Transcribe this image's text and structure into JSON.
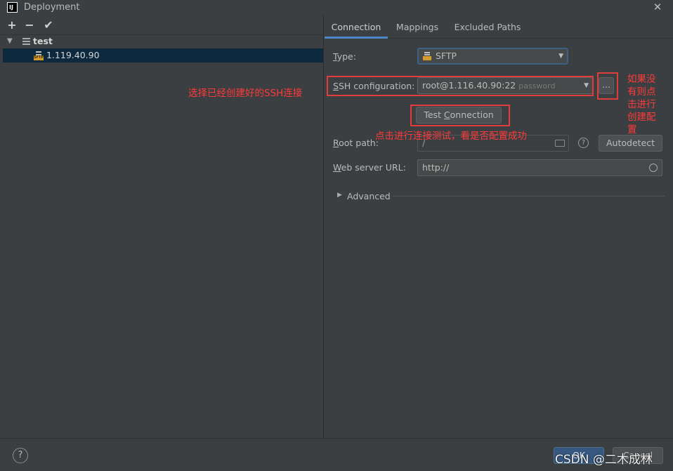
{
  "window": {
    "title": "Deployment",
    "close_symbol": "✕"
  },
  "toolbar": {
    "add": "+",
    "remove": "−",
    "apply": "✔"
  },
  "tree": {
    "root_label": "test",
    "server_label": "1.119.40.90",
    "sftp_tag": "SFTP"
  },
  "tabs": [
    {
      "label": "Connection"
    },
    {
      "label": "Mappings"
    },
    {
      "label": "Excluded Paths"
    }
  ],
  "form": {
    "type_label_pre": "",
    "type_label_key": "T",
    "type_label_post": "ype:",
    "type_value": "SFTP",
    "ssh_label_pre": "",
    "ssh_label_key": "S",
    "ssh_label_post": "SH configuration:",
    "ssh_value": "root@1.116.40.90:22",
    "ssh_hint": "password",
    "browse_label": "...",
    "test_connection_pre": "Test ",
    "test_connection_key": "C",
    "test_connection_post": "onnection",
    "root_label_pre": "",
    "root_label_key": "R",
    "root_label_post": "oot path:",
    "root_value": "/",
    "autodetect_label": "Autodetect",
    "web_label_pre": "",
    "web_label_key": "W",
    "web_label_post": "eb server URL:",
    "web_value": "http://",
    "advanced_label": "Advanced"
  },
  "annotations": {
    "select_ssh": "选择已经创建好的SSH连接",
    "create_if_missing_lines": [
      "如果没",
      "有则点",
      "击进行",
      "创建配",
      "置"
    ],
    "test_hint": "点击进行连接测试，看是否配置成功"
  },
  "footer": {
    "help": "?",
    "ok": "OK",
    "cancel": "Cancel",
    "watermark": "CSDN @二木成林"
  },
  "colors": {
    "accent": "#4a88c7",
    "annotation": "#e03c3c",
    "ok_button": "#365880"
  }
}
